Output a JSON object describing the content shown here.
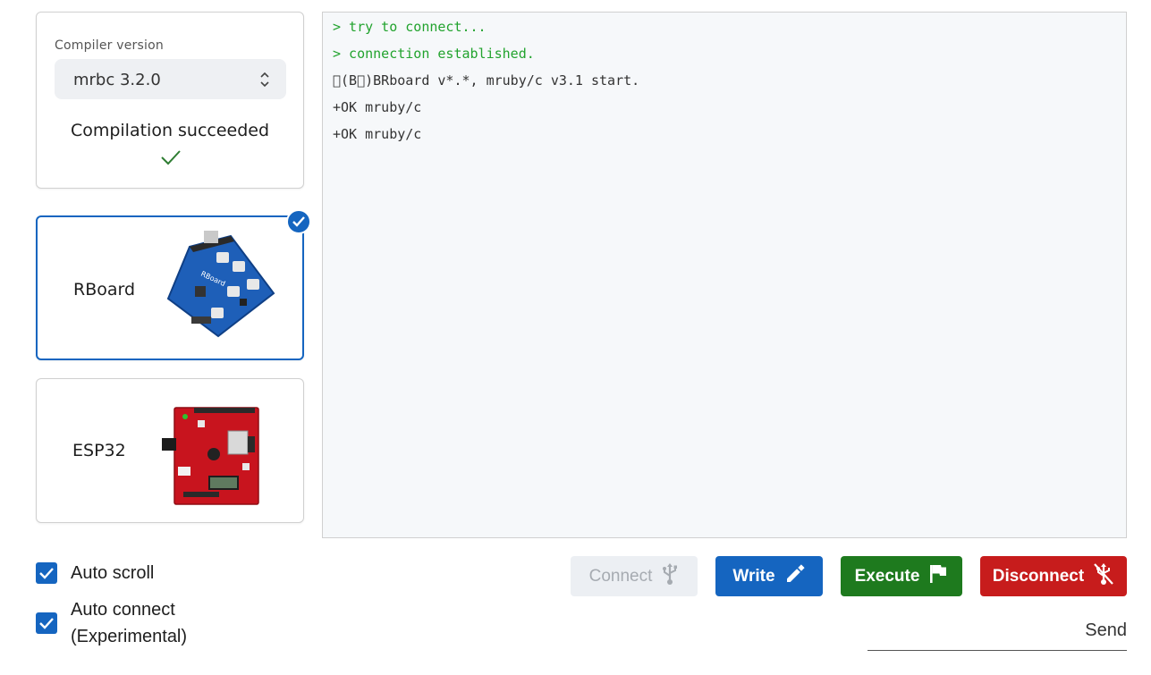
{
  "compiler": {
    "label": "Compiler version",
    "selected": "mrbc 3.2.0",
    "status": "Compilation succeeded"
  },
  "boards": [
    {
      "name": "RBoard",
      "selected": true,
      "image_icon": "rboard-pcb-image"
    },
    {
      "name": "ESP32",
      "selected": false,
      "image_icon": "esp32-pcb-image"
    }
  ],
  "options": {
    "auto_scroll": {
      "label": "Auto scroll",
      "checked": true
    },
    "auto_connect": {
      "label_line1": "Auto connect",
      "label_line2": "(Experimental)",
      "checked": true
    }
  },
  "terminal": {
    "lines": [
      {
        "text": "> try to connect...",
        "color": "#22a32e"
      },
      {
        "text": "> connection established.",
        "color": "#22a32e"
      },
      {
        "text": "\u0000(B\u0000)BRboard v*.*, mruby/c v3.1 start.",
        "color": "#333333"
      },
      {
        "text": "+OK mruby/c",
        "color": "#333333"
      },
      {
        "text": "+OK mruby/c",
        "color": "#333333"
      }
    ]
  },
  "actions": {
    "connect": {
      "label": "Connect",
      "icon": "usb-icon",
      "enabled": false
    },
    "write": {
      "label": "Write",
      "icon": "pencil-icon",
      "color": "#1565c0"
    },
    "execute": {
      "label": "Execute",
      "icon": "flag-icon",
      "color": "#1e7a1e"
    },
    "disconnect": {
      "label": "Disconnect",
      "icon": "usb-off-icon",
      "color": "#c71c1c"
    }
  },
  "send": {
    "label": "Send"
  }
}
